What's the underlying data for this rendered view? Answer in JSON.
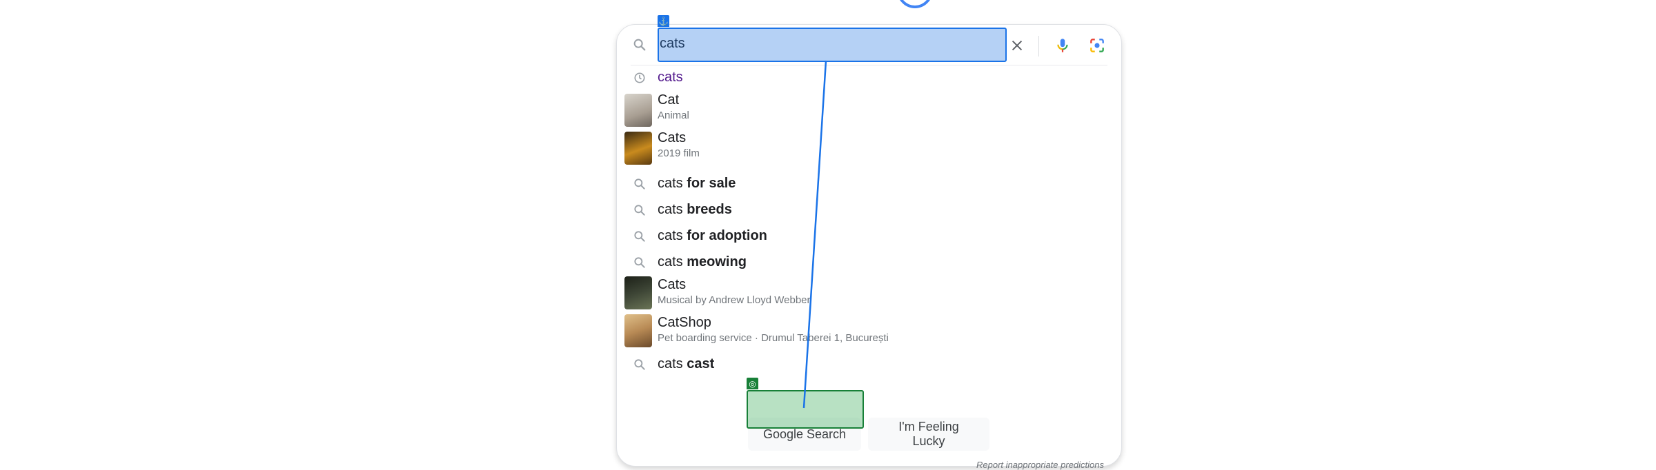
{
  "search": {
    "query": "cats",
    "icons": {
      "search": "search-icon",
      "clear": "close-icon",
      "voice": "microphone-icon",
      "lens": "camera-lens-icon"
    }
  },
  "suggestions": [
    {
      "type": "history",
      "icon": "history-icon",
      "text": "cats",
      "bold": ""
    },
    {
      "type": "entity",
      "thumb_color": "#b8b0a6",
      "text": "Cat",
      "bold": "",
      "subtitle": "Animal"
    },
    {
      "type": "entity",
      "thumb_color": "#c98b1e",
      "text": "Cats",
      "bold": "",
      "subtitle": "2019 film"
    },
    {
      "type": "query",
      "icon": "search-icon",
      "text": "cats ",
      "bold": "for sale"
    },
    {
      "type": "query",
      "icon": "search-icon",
      "text": "cats ",
      "bold": "breeds"
    },
    {
      "type": "query",
      "icon": "search-icon",
      "text": "cats ",
      "bold": "for adoption"
    },
    {
      "type": "query",
      "icon": "search-icon",
      "text": "cats ",
      "bold": "meowing"
    },
    {
      "type": "entity",
      "thumb_color": "#3e4636",
      "text": "Cats",
      "bold": "",
      "subtitle": "Musical by Andrew Lloyd Webber"
    },
    {
      "type": "entity",
      "thumb_color": "#b88a55",
      "text": "CatShop",
      "bold": "",
      "subtitle": "Pet boarding service · Drumul Taberei 1, București"
    },
    {
      "type": "query",
      "icon": "search-icon",
      "text": "cats ",
      "bold": "cast"
    }
  ],
  "buttons": {
    "search": "Google Search",
    "lucky": "I'm Feeling Lucky"
  },
  "footer": {
    "report": "Report inappropriate predictions"
  },
  "overlay": {
    "anchor_glyph": "⚓",
    "target_glyph": "◎",
    "source_color": "#1a73e8",
    "target_color": "#188038"
  }
}
